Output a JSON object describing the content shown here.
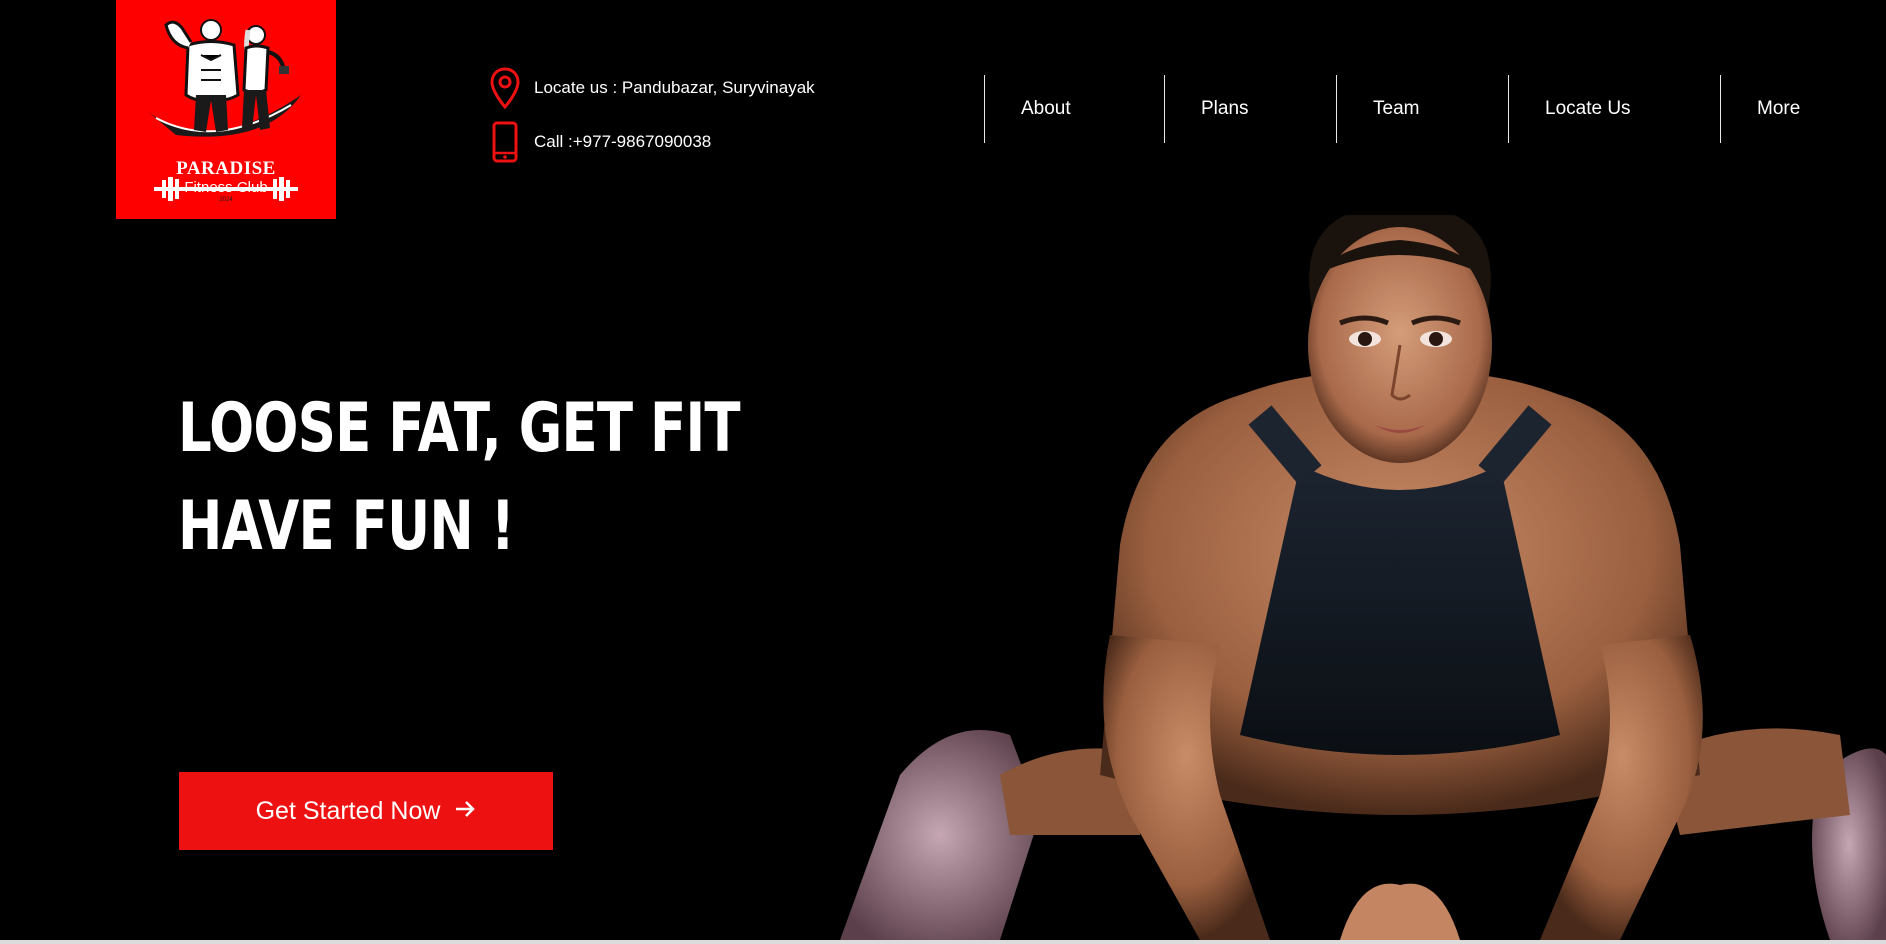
{
  "brand": {
    "line1": "PARADISE",
    "line2": "Fitness Club",
    "line3": "2024",
    "logo_bg": "#ff0000"
  },
  "contact": {
    "location_icon": "map-pin-icon",
    "location": "Locate us : Pandubazar, Suryvinayak",
    "phone_icon": "mobile-phone-icon",
    "phone": "Call :+977-9867090038",
    "icon_color": "#ee1111"
  },
  "nav": {
    "items": [
      {
        "label": "About"
      },
      {
        "label": "Plans"
      },
      {
        "label": "Team"
      },
      {
        "label": "Locate Us"
      },
      {
        "label": "More"
      }
    ]
  },
  "hero": {
    "title_line1": "LOOSE FAT, GET FIT",
    "title_line2": "HAVE FUN !",
    "cta_label": "Get Started Now",
    "cta_icon": "arrow-right-icon",
    "cta_color": "#ee1111",
    "photo": "woman-plank-exercise-photo"
  }
}
